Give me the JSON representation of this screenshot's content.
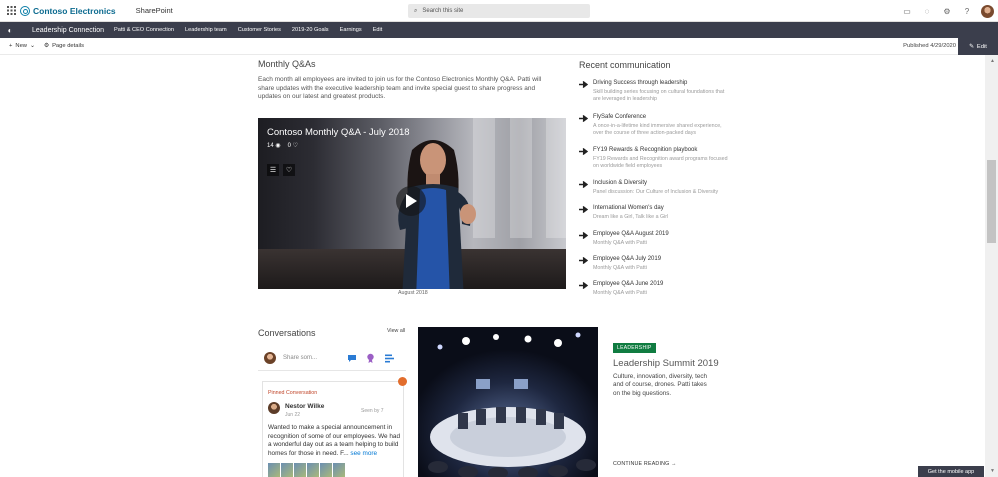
{
  "suite": {
    "brand": "Contoso Electronics",
    "app": "SharePoint",
    "search_placeholder": "Search this site"
  },
  "hub": {
    "title": "Leadership Connection",
    "nav": [
      "Patti & CEO Connection",
      "Leadership team",
      "Customer Stories",
      "2019-20 Goals",
      "Earnings",
      "Edit"
    ]
  },
  "commandbar": {
    "new_label": "New",
    "page_details_label": "Page details",
    "published": "Published 4/29/2020",
    "edit_label": "Edit"
  },
  "qa": {
    "heading": "Monthly Q&As",
    "description": "Each month all employees are invited to join us for the Contoso Electronics Monthly Q&A. Patti will share updates with the executive leadership team and invite special guest to share progress and updates on our latest and greatest products.",
    "video_title": "Contoso Monthly Q&A - July 2018",
    "views": "14",
    "likes": "0",
    "caption": "August 2018"
  },
  "recent": {
    "heading": "Recent communication",
    "items": [
      {
        "title": "Driving Success through leadership",
        "subtitle": "Skill building series focusing on cultural foundations that are leveraged in leadership"
      },
      {
        "title": "FlySafe Conference",
        "subtitle": "A once-in-a-lifetime kind immersive shared experience, over the course of three action-packed days"
      },
      {
        "title": "FY19 Rewards & Recognition playbook",
        "subtitle": "FY19 Rewards and Recognition award programs focused on worldwide field employees"
      },
      {
        "title": "Inclusion & Diversity",
        "subtitle": "Panel discussion: Our Culture of Inclusion & Diversity"
      },
      {
        "title": "International Women's day",
        "subtitle": "Dream like a Girl, Talk like a Girl"
      },
      {
        "title": "Employee Q&A August 2019",
        "subtitle": "Monthly Q&A with Patti"
      },
      {
        "title": "Employee Q&A July 2019",
        "subtitle": "Monthly Q&A with Patti"
      },
      {
        "title": "Employee Q&A June 2019",
        "subtitle": "Monthly Q&A with Patti"
      }
    ]
  },
  "conversations": {
    "heading": "Conversations",
    "view_all": "View all",
    "share_placeholder": "Share som...",
    "pinned_label": "Pinned Conversation",
    "author": "Nestor Wilke",
    "date": "Jun 22",
    "seen_by": "Seen by 7",
    "body": "Wanted to make a special announcement in recognition of some of our employees. We had a wonderful day out as a team helping to build homes for those in need. F...",
    "see_more": "see more"
  },
  "summit": {
    "tag": "LEADERSHIP",
    "title": "Leadership Summit 2019",
    "body": "Culture, innovation, diversity, tech and of course, drones. Patti takes on the big questions.",
    "cta": "CONTINUE READING",
    "cta_arrow": "→"
  },
  "mobile_button": "Get the mobile app",
  "colors": {
    "nav_bg": "#3b3e4c",
    "brand": "#0b6a8f",
    "tag_green": "#107c41",
    "pinned_orange": "#c0462a"
  }
}
